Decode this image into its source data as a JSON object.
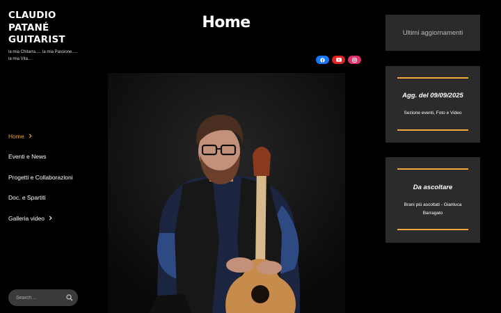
{
  "site": {
    "title_lines": [
      "CLAUDIO",
      "PATANÉ",
      "GUITARIST"
    ],
    "tagline": "la mia Chitarra..... la mia Passione..... la mia Vita..."
  },
  "nav": {
    "items": [
      {
        "label": "Home",
        "active": true,
        "has_submenu": true
      },
      {
        "label": "Eventi e News",
        "active": false,
        "has_submenu": false
      },
      {
        "label": "Progetti e Collaborazioni",
        "active": false,
        "has_submenu": false
      },
      {
        "label": "Doc. e Spartiti",
        "active": false,
        "has_submenu": false
      },
      {
        "label": "Galleria video",
        "active": false,
        "has_submenu": true
      }
    ]
  },
  "search": {
    "placeholder": "Search ...",
    "icon": "search-icon"
  },
  "main": {
    "title": "Home",
    "socials": [
      {
        "name": "facebook-icon",
        "color": "#1877f2"
      },
      {
        "name": "youtube-icon",
        "color": "#e02424"
      },
      {
        "name": "instagram-icon",
        "color": "#e1306c"
      }
    ]
  },
  "widgets": {
    "updates": {
      "label": "Ultimi aggiornamenti"
    },
    "last_update": {
      "title": "Agg. del 09/09/2025",
      "text": "Sezione eventi, Foto e Video"
    },
    "listen": {
      "title": "Da ascoltare",
      "text": "Brani più ascoltati - Gianluca Barragato"
    }
  },
  "colors": {
    "accent": "#f3a73c",
    "widget_bg": "#2b2b2b",
    "background": "#000000"
  }
}
